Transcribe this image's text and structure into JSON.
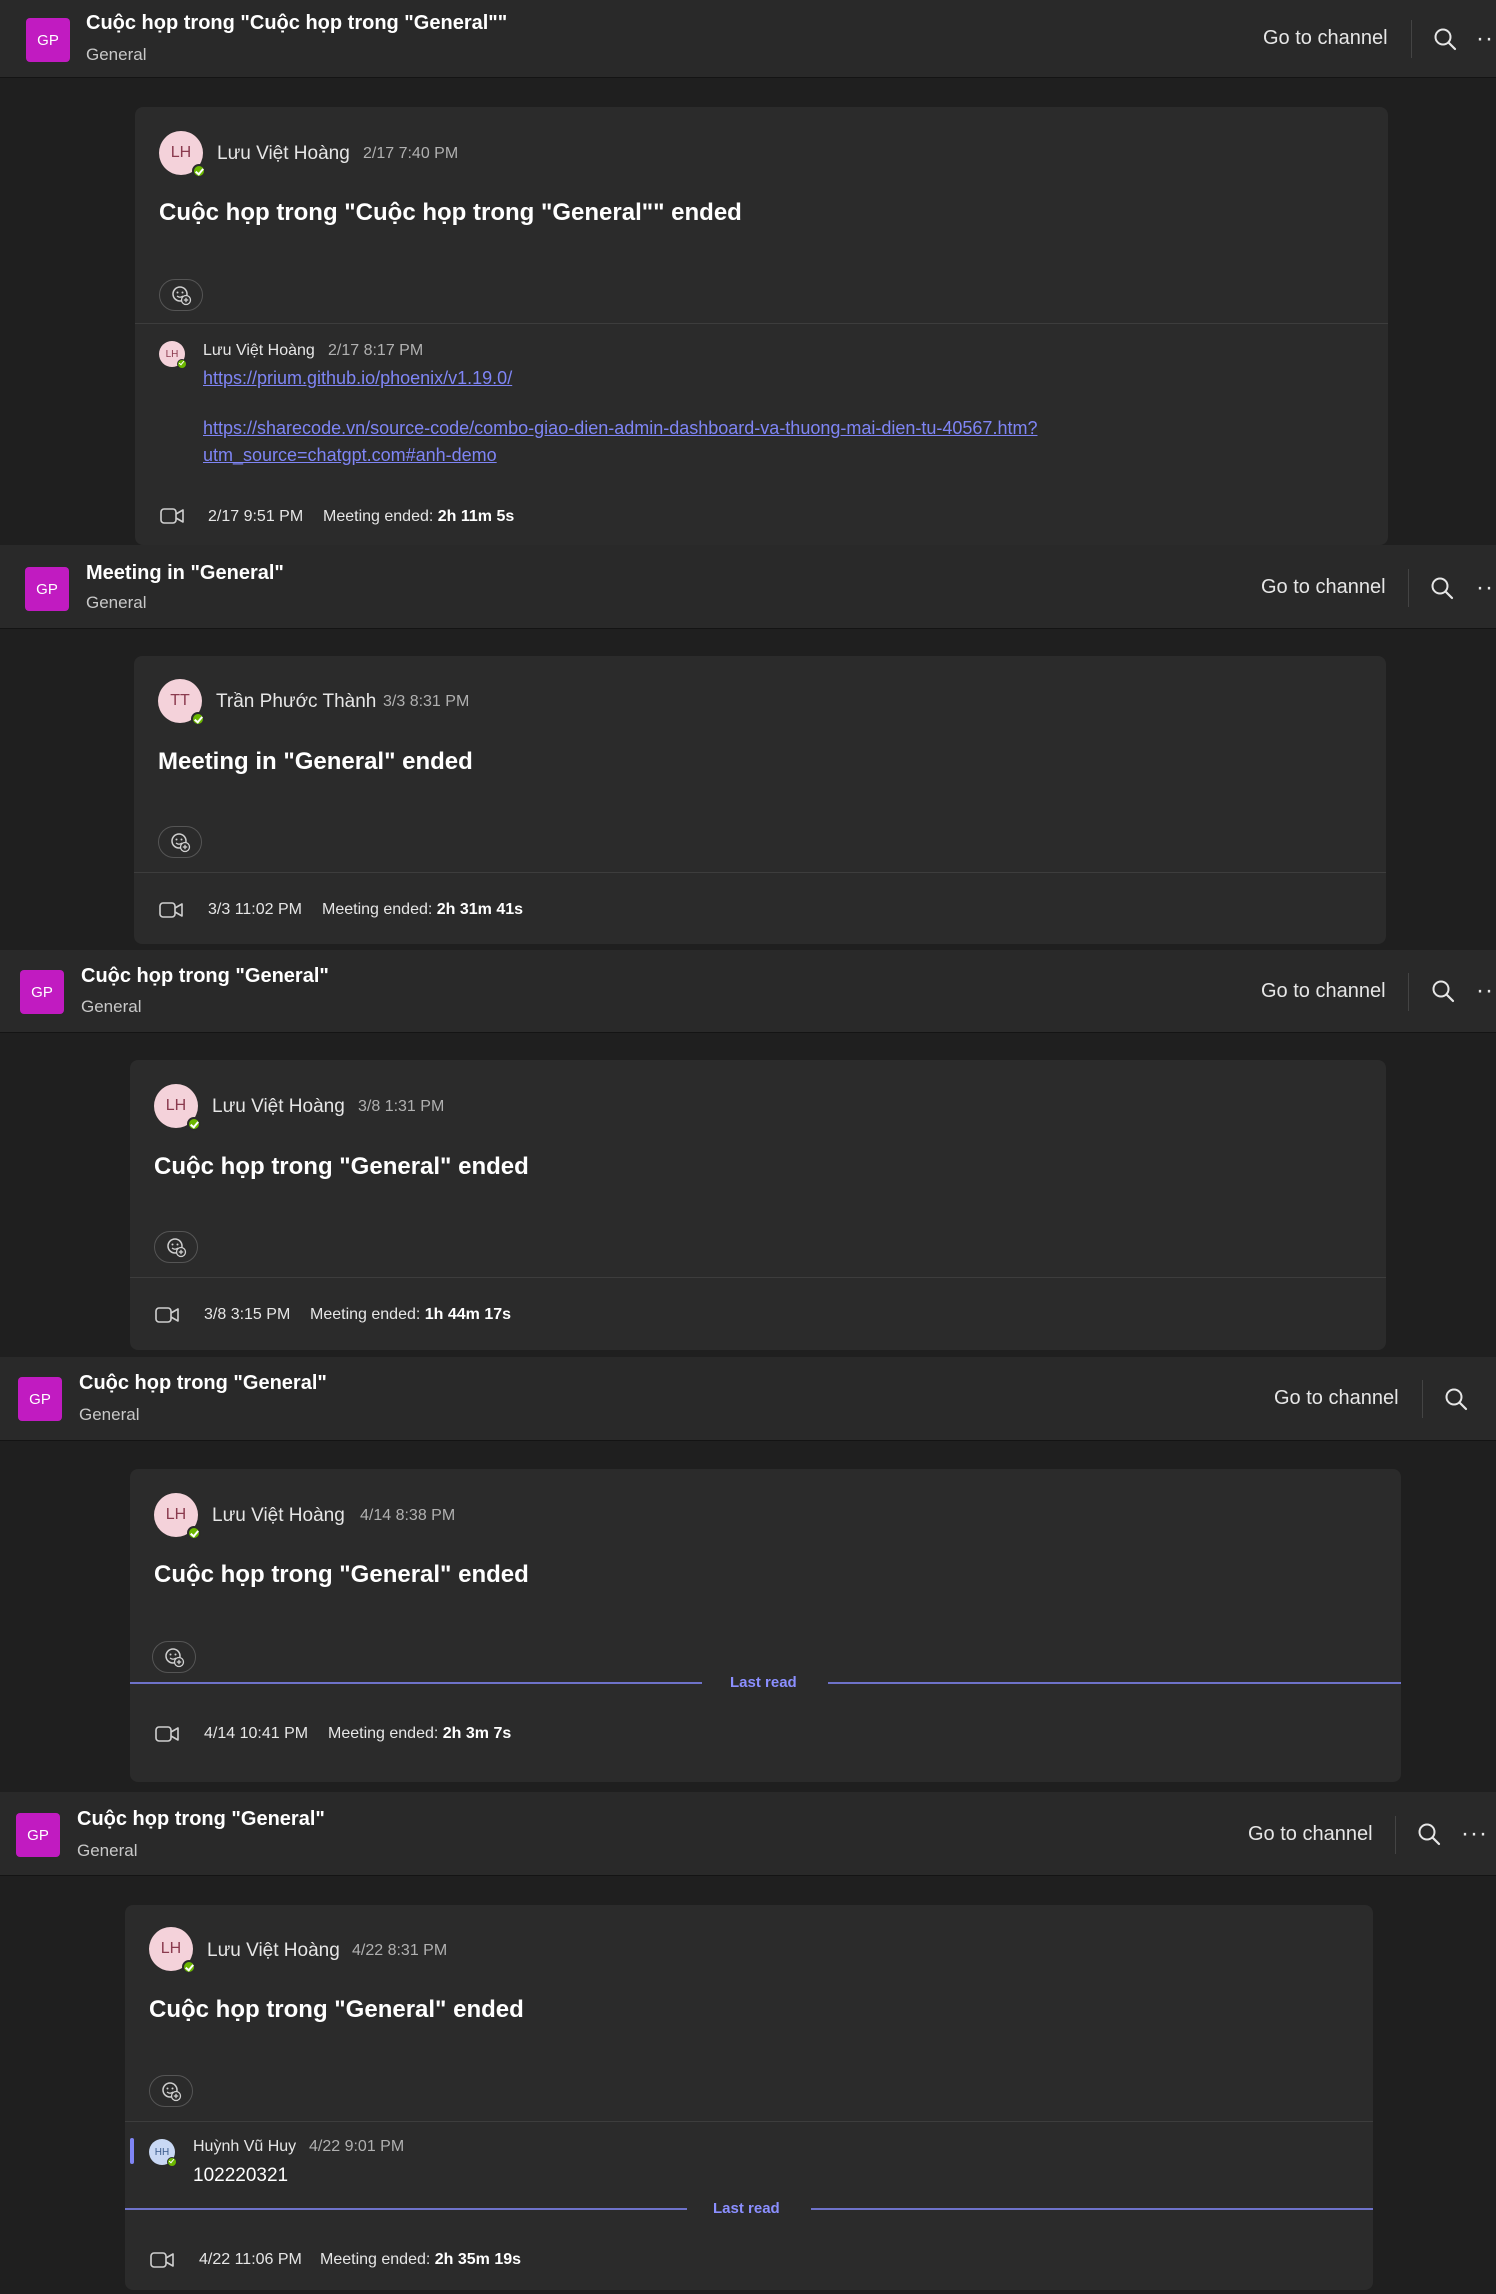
{
  "common": {
    "team_initials": "GP",
    "go_to_channel": "Go to channel",
    "more": "···",
    "meeting_ended_label": "Meeting ended:",
    "last_read": "Last read"
  },
  "threads": [
    {
      "header": {
        "title": "Cuộc họp trong \"Cuộc họp trong \"General\"\"",
        "subtitle": "General"
      },
      "author_initials": "LH",
      "author": "Lưu Việt Hoàng",
      "time": "2/17 7:40 PM",
      "message": "Cuộc họp trong \"Cuộc họp trong \"General\"\" ended",
      "reply": {
        "initials": "LH",
        "author": "Lưu Việt Hoàng",
        "time": "2/17 8:17 PM",
        "links": [
          "https://prium.github.io/phoenix/v1.19.0/",
          "https://sharecode.vn/source-code/combo-giao-dien-admin-dashboard-va-thuong-mai-dien-tu-40567.htm?",
          "utm_source=chatgpt.com#anh-demo"
        ]
      },
      "meeting_time": "2/17 9:51 PM",
      "duration": "2h 11m 5s"
    },
    {
      "header": {
        "title": "Meeting in \"General\"",
        "subtitle": "General"
      },
      "author_initials": "TT",
      "author": "Trần Phước Thành",
      "time": "3/3 8:31 PM",
      "message": "Meeting in \"General\" ended",
      "meeting_time": "3/3 11:02 PM",
      "duration": "2h 31m 41s"
    },
    {
      "header": {
        "title": "Cuộc họp trong \"General\"",
        "subtitle": "General"
      },
      "author_initials": "LH",
      "author": "Lưu Việt Hoàng",
      "time": "3/8 1:31 PM",
      "message": "Cuộc họp trong \"General\" ended",
      "meeting_time": "3/8 3:15 PM",
      "duration": "1h 44m 17s"
    },
    {
      "header": {
        "title": "Cuộc họp trong \"General\"",
        "subtitle": "General"
      },
      "author_initials": "LH",
      "author": "Lưu Việt Hoàng",
      "time": "4/14 8:38 PM",
      "message": "Cuộc họp trong \"General\" ended",
      "meeting_time": "4/14 10:41 PM",
      "duration": "2h 3m 7s"
    },
    {
      "header": {
        "title": "Cuộc họp trong \"General\"",
        "subtitle": "General"
      },
      "author_initials": "LH",
      "author": "Lưu Việt Hoàng",
      "time": "4/22 8:31 PM",
      "message": "Cuộc họp trong \"General\" ended",
      "reply": {
        "initials": "HH",
        "author": "Huỳnh Vũ Huy",
        "time": "4/22 9:01 PM",
        "text": "102220321"
      },
      "meeting_time": "4/22 11:06 PM",
      "duration": "2h 35m 19s"
    }
  ]
}
